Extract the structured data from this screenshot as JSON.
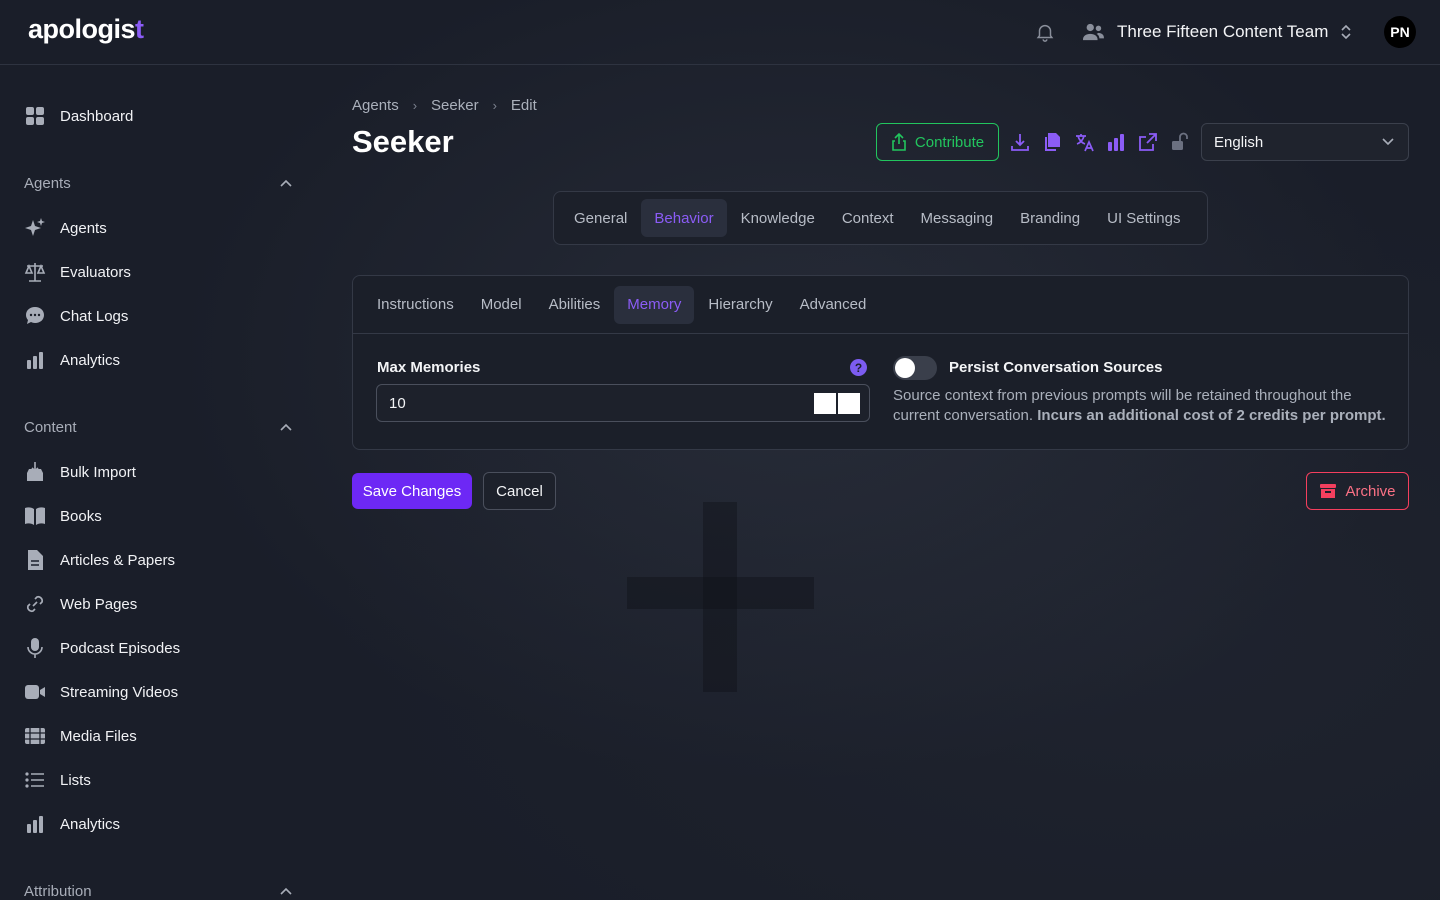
{
  "app": {
    "logo_text": "apologis",
    "logo_accent": "t"
  },
  "topbar": {
    "team_name": "Three Fifteen Content Team",
    "avatar_initials": "PN"
  },
  "sidebar": {
    "dashboard": "Dashboard",
    "agents_section": "Agents",
    "agents_items": [
      "Agents",
      "Evaluators",
      "Chat Logs",
      "Analytics"
    ],
    "content_section": "Content",
    "content_items": [
      "Bulk Import",
      "Books",
      "Articles & Papers",
      "Web Pages",
      "Podcast Episodes",
      "Streaming Videos",
      "Media Files",
      "Lists",
      "Analytics"
    ],
    "attribution_section": "Attribution"
  },
  "breadcrumb": [
    "Agents",
    "Seeker",
    "Edit"
  ],
  "page": {
    "title": "Seeker"
  },
  "toolbar": {
    "contribute_label": "Contribute",
    "language": "English"
  },
  "tabs": [
    "General",
    "Behavior",
    "Knowledge",
    "Context",
    "Messaging",
    "Branding",
    "UI Settings"
  ],
  "active_tab": "Behavior",
  "subtabs": [
    "Instructions",
    "Model",
    "Abilities",
    "Memory",
    "Hierarchy",
    "Advanced"
  ],
  "active_subtab": "Memory",
  "memory": {
    "max_label": "Max Memories",
    "help": "?",
    "max_value": "10",
    "persist_label": "Persist Conversation Sources",
    "persist_enabled": false,
    "persist_desc": "Source context from previous prompts will be retained throughout the current conversation.",
    "persist_cost": "Incurs an additional cost of 2 credits per prompt."
  },
  "actions": {
    "save": "Save Changes",
    "cancel": "Cancel",
    "archive": "Archive"
  },
  "colors": {
    "accent": "#8b5cf6",
    "primary": "#6d28f5",
    "success": "#22c55e",
    "danger": "#f43f5e"
  }
}
